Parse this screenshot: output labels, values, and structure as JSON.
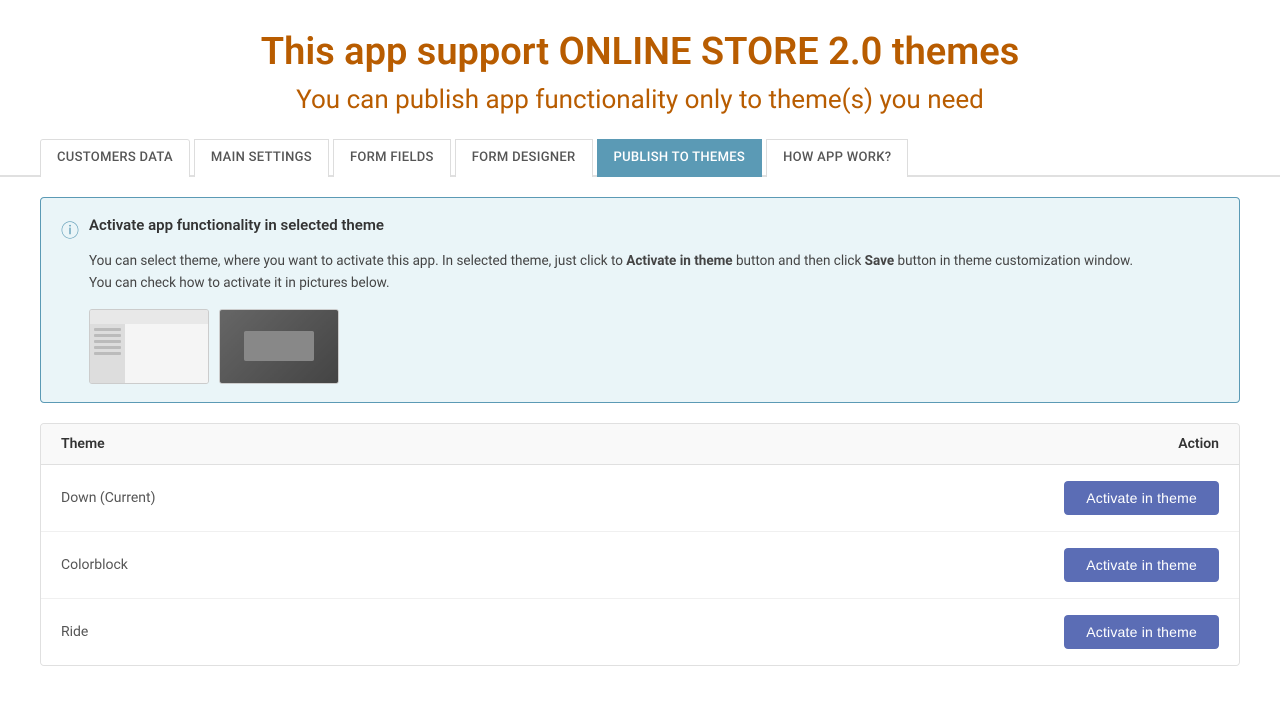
{
  "header": {
    "title": "This app support ONLINE STORE 2.0 themes",
    "subtitle": "You can publish app functionality only to theme(s) you need"
  },
  "tabs": [
    {
      "id": "customers-data",
      "label": "CUSTOMERS DATA",
      "active": false
    },
    {
      "id": "main-settings",
      "label": "MAIN SETTINGS",
      "active": false
    },
    {
      "id": "form-fields",
      "label": "FORM FIELDS",
      "active": false
    },
    {
      "id": "form-designer",
      "label": "FORM DESIGNER",
      "active": false
    },
    {
      "id": "publish-to-themes",
      "label": "PUBLISH TO THEMES",
      "active": true
    },
    {
      "id": "how-app-work",
      "label": "HOW APP WORK?",
      "active": false
    }
  ],
  "infoBox": {
    "title": "Activate app functionality in selected theme",
    "bodyPart1": "You can select theme, where you want to activate this app. In selected theme, just click to ",
    "boldText1": "Activate in theme",
    "bodyPart2": " button and then click ",
    "boldText2": "Save",
    "bodyPart3": " button in theme customization window.",
    "bodyLine2": "You can check how to activate it in pictures below."
  },
  "table": {
    "headers": {
      "theme": "Theme",
      "action": "Action"
    },
    "rows": [
      {
        "id": "row-1",
        "name": "Down (Current)",
        "button": "Activate in theme"
      },
      {
        "id": "row-2",
        "name": "Colorblock",
        "button": "Activate in theme"
      },
      {
        "id": "row-3",
        "name": "Ride",
        "button": "Activate in theme"
      }
    ]
  }
}
